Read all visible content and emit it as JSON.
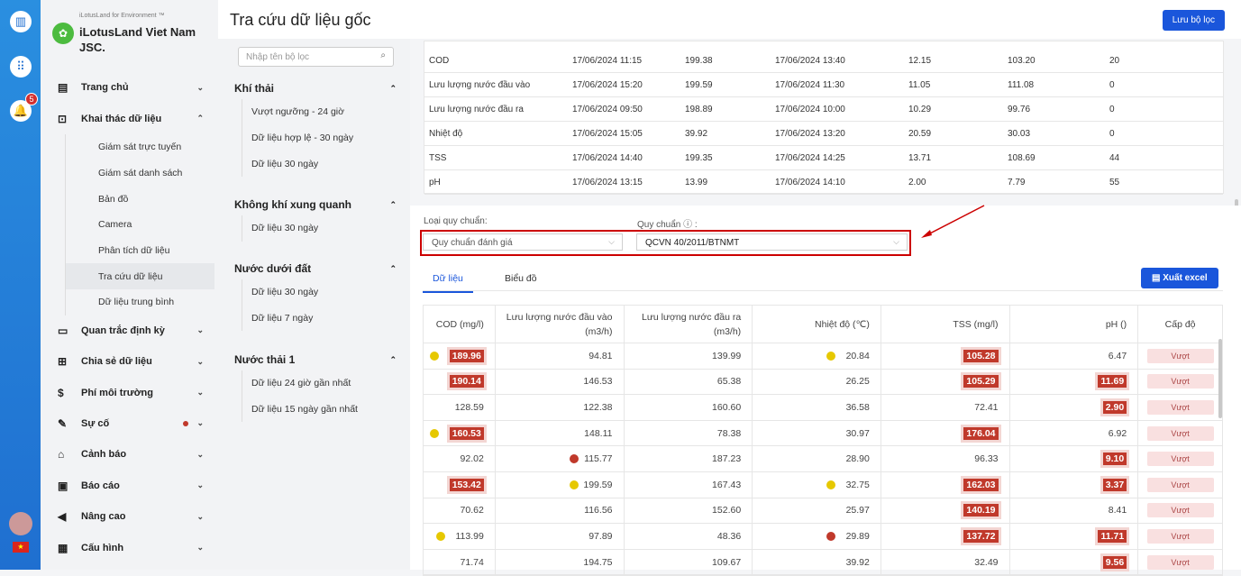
{
  "rail": {
    "notif_count": "5",
    "flag": "★"
  },
  "brand": {
    "sub": "iLotusLand for Environment ™",
    "name": "iLotusLand Viet Nam JSC."
  },
  "nav": [
    {
      "label": "Trang chủ",
      "icon": "▤",
      "open": false
    },
    {
      "label": "Khai thác dữ liệu",
      "icon": "⊡",
      "open": true,
      "subs": [
        "Giám sát trực tuyến",
        "Giám sát danh sách",
        "Bản đồ",
        "Camera",
        "Phân tích dữ liệu",
        "Tra cứu dữ liệu",
        "Dữ liệu trung bình"
      ],
      "active": 5
    },
    {
      "label": "Quan trắc định kỳ",
      "icon": "▭",
      "open": false
    },
    {
      "label": "Chia sẻ dữ liệu",
      "icon": "⊞",
      "open": false
    },
    {
      "label": "Phí môi trường",
      "icon": "$",
      "open": false
    },
    {
      "label": "Sự cố",
      "icon": "✎",
      "open": false,
      "dot": true
    },
    {
      "label": "Cảnh báo",
      "icon": "⌂",
      "open": false
    },
    {
      "label": "Báo cáo",
      "icon": "▣",
      "open": false
    },
    {
      "label": "Nâng cao",
      "icon": "◀",
      "open": false
    },
    {
      "label": "Cấu hình",
      "icon": "▦",
      "open": false
    }
  ],
  "header": {
    "title": "Tra cứu dữ liệu gốc",
    "save_filter": "Lưu bộ lọc"
  },
  "filter": {
    "placeholder": "Nhập tên bộ lọc",
    "groups": [
      {
        "title": "Khí thải",
        "items": [
          "Vượt ngưỡng - 24 giờ",
          "Dữ liệu hợp lệ - 30 ngày",
          "Dữ liệu 30 ngày"
        ]
      },
      {
        "title": "Không khí xung quanh",
        "items": [
          "Dữ liệu 30 ngày"
        ]
      },
      {
        "title": "Nước dưới đất",
        "items": [
          "Dữ liệu 30 ngày",
          "Dữ liệu 7 ngày"
        ]
      },
      {
        "title": "Nước thải 1",
        "items": [
          "Dữ liệu 24 giờ gần nhất",
          "Dữ liệu 15 ngày gần nhất"
        ]
      }
    ]
  },
  "summary": [
    [
      "COD",
      "17/06/2024 11:15",
      "199.38",
      "17/06/2024 13:40",
      "12.15",
      "103.20",
      "20"
    ],
    [
      "Lưu lượng nước đầu vào",
      "17/06/2024 15:20",
      "199.59",
      "17/06/2024 11:30",
      "11.05",
      "111.08",
      "0"
    ],
    [
      "Lưu lượng nước đầu ra",
      "17/06/2024 09:50",
      "198.89",
      "17/06/2024 10:00",
      "10.29",
      "99.76",
      "0"
    ],
    [
      "Nhiệt độ",
      "17/06/2024 15:05",
      "39.92",
      "17/06/2024 13:20",
      "20.59",
      "30.03",
      "0"
    ],
    [
      "TSS",
      "17/06/2024 14:40",
      "199.35",
      "17/06/2024 14:25",
      "13.71",
      "108.69",
      "44"
    ],
    [
      "pH",
      "17/06/2024 13:15",
      "13.99",
      "17/06/2024 14:10",
      "2.00",
      "7.79",
      "55"
    ]
  ],
  "standard": {
    "type_label": "Loại quy chuẩn:",
    "type_value": "Quy chuẩn đánh giá",
    "std_label": "Quy chuẩn ⓘ :",
    "std_value": "QCVN 40/2011/BTNMT"
  },
  "tabs": {
    "data": "Dữ liệu",
    "chart": "Biểu đồ",
    "export": "Xuất excel"
  },
  "colors": {
    "accent": "#1a56db",
    "exceed": "#c0392b",
    "yellow": "#e6c800",
    "red": "#c0392b"
  },
  "table": {
    "headers": [
      "COD (mg/l)",
      "Lưu lượng nước đầu vào (m3/h)",
      "Lưu lượng nước đầu ra (m3/h)",
      "Nhiệt độ (℃)",
      "TSS (mg/l)",
      "pH ()",
      "Cấp độ"
    ],
    "rows": [
      {
        "cells": [
          {
            "v": "189.96",
            "dot": "yellow",
            "hl": true
          },
          {
            "v": "94.81"
          },
          {
            "v": "139.99"
          },
          {
            "v": "20.84",
            "dot": "yellow"
          },
          {
            "v": "105.28",
            "hl": true
          },
          {
            "v": "6.47"
          }
        ],
        "level": "Vượt"
      },
      {
        "cells": [
          {
            "v": "190.14",
            "hl": true
          },
          {
            "v": "146.53"
          },
          {
            "v": "65.38"
          },
          {
            "v": "26.25"
          },
          {
            "v": "105.29",
            "hl": true
          },
          {
            "v": "11.69",
            "hl": true
          }
        ],
        "level": "Vượt"
      },
      {
        "cells": [
          {
            "v": "128.59"
          },
          {
            "v": "122.38"
          },
          {
            "v": "160.60"
          },
          {
            "v": "36.58"
          },
          {
            "v": "72.41"
          },
          {
            "v": "2.90",
            "hl": true
          }
        ],
        "level": "Vượt"
      },
      {
        "cells": [
          {
            "v": "160.53",
            "dot": "yellow",
            "hl": true
          },
          {
            "v": "148.11"
          },
          {
            "v": "78.38"
          },
          {
            "v": "30.97"
          },
          {
            "v": "176.04",
            "hl": true
          },
          {
            "v": "6.92"
          }
        ],
        "level": "Vượt"
      },
      {
        "cells": [
          {
            "v": "92.02"
          },
          {
            "v": "115.77",
            "dot": "red"
          },
          {
            "v": "187.23"
          },
          {
            "v": "28.90"
          },
          {
            "v": "96.33"
          },
          {
            "v": "9.10",
            "hl": true
          }
        ],
        "level": "Vượt"
      },
      {
        "cells": [
          {
            "v": "153.42",
            "hl": true
          },
          {
            "v": "199.59",
            "dot": "yellow"
          },
          {
            "v": "167.43"
          },
          {
            "v": "32.75",
            "dot": "yellow"
          },
          {
            "v": "162.03",
            "hl": true
          },
          {
            "v": "3.37",
            "hl": true
          }
        ],
        "level": "Vượt"
      },
      {
        "cells": [
          {
            "v": "70.62"
          },
          {
            "v": "116.56"
          },
          {
            "v": "152.60"
          },
          {
            "v": "25.97"
          },
          {
            "v": "140.19",
            "hl": true
          },
          {
            "v": "8.41"
          }
        ],
        "level": "Vượt"
      },
      {
        "cells": [
          {
            "v": "113.99",
            "dot": "yellow"
          },
          {
            "v": "97.89"
          },
          {
            "v": "48.36"
          },
          {
            "v": "29.89",
            "dot": "red"
          },
          {
            "v": "137.72",
            "hl": true
          },
          {
            "v": "11.71",
            "hl": true
          }
        ],
        "level": "Vượt"
      },
      {
        "cells": [
          {
            "v": "71.74"
          },
          {
            "v": "194.75"
          },
          {
            "v": "109.67"
          },
          {
            "v": "39.92"
          },
          {
            "v": "32.49"
          },
          {
            "v": "9.56",
            "hl": true
          }
        ],
        "level": "Vượt"
      }
    ]
  }
}
